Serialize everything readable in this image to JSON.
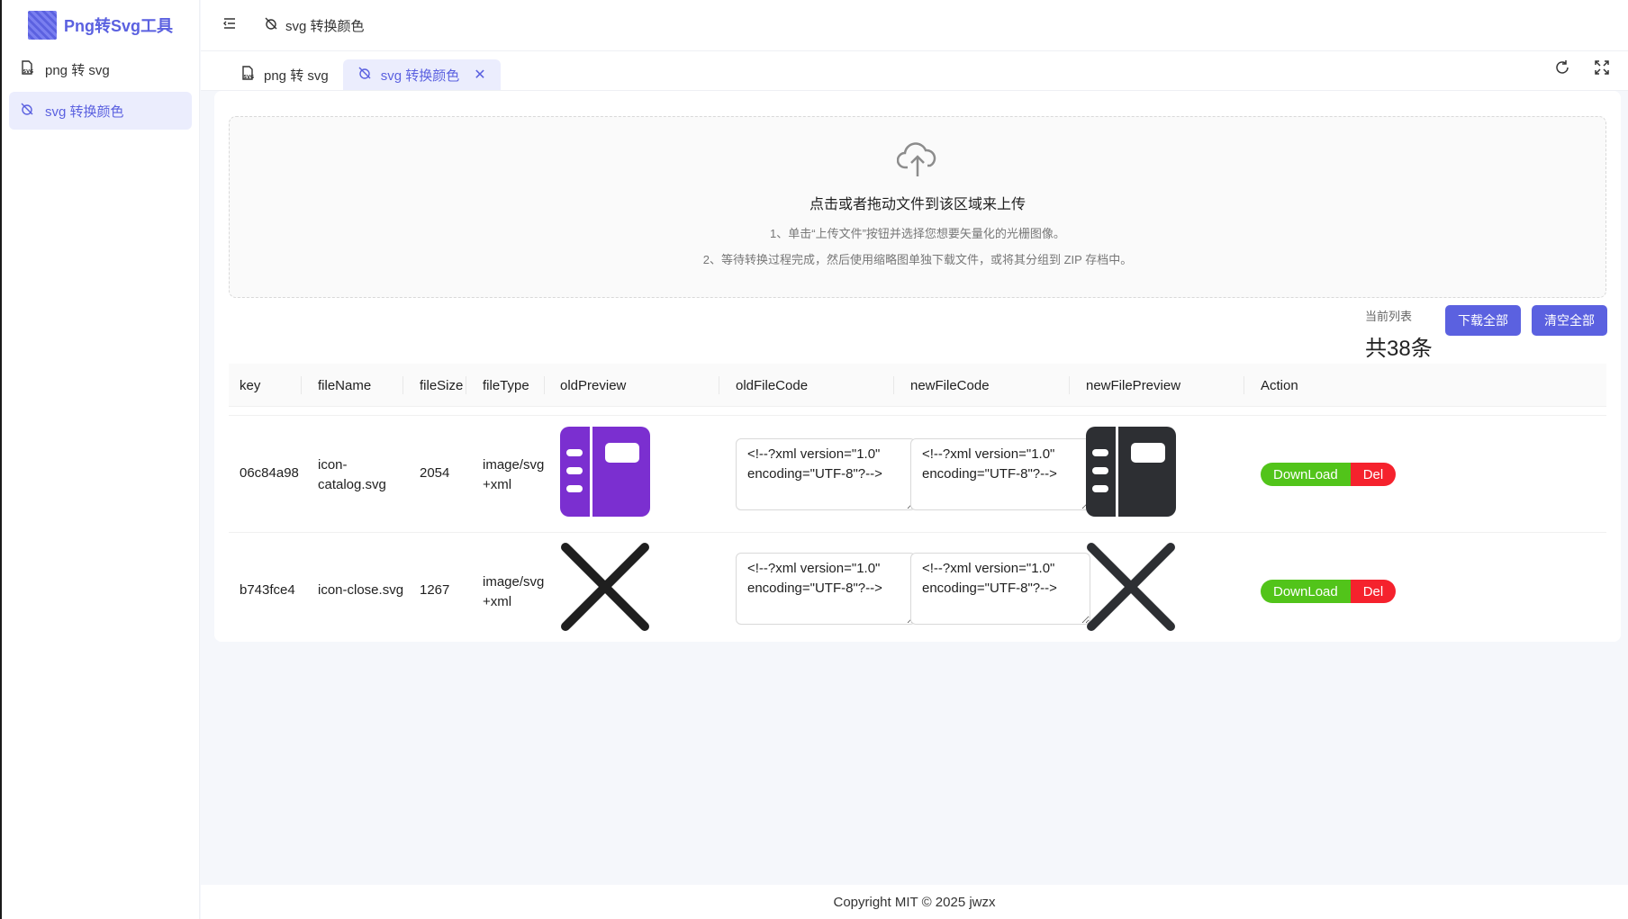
{
  "app": {
    "title": "Png转Svg工具"
  },
  "sidebar": {
    "items": [
      {
        "label": "png 转 svg"
      },
      {
        "label": "svg 转换颜色"
      }
    ]
  },
  "topbar": {
    "breadcrumb": "svg 转换颜色"
  },
  "tabs": [
    {
      "label": "png 转 svg"
    },
    {
      "label": "svg 转换颜色"
    }
  ],
  "upload": {
    "title": "点击或者拖动文件到该区域来上传",
    "hint1": "1、单击“上传文件”按钮并选择您想要矢量化的光栅图像。",
    "hint2": "2、等待转换过程完成，然后使用缩略图单独下载文件，或将其分组到 ZIP 存档中。"
  },
  "list": {
    "label": "当前列表",
    "count": "共38条",
    "download_all": "下载全部",
    "clear_all": "清空全部"
  },
  "table": {
    "headers": [
      "key",
      "fileName",
      "fileSize",
      "fileType",
      "oldPreview",
      "oldFileCode",
      "newFileCode",
      "newFilePreview",
      "Action"
    ],
    "rows": [
      {
        "key": "06c84a98",
        "fileName": "icon-catalog.svg",
        "fileSize": "2054",
        "fileType": "image/svg+xml",
        "oldFileCode": "<!--?xml version=\"1.0\" encoding=\"UTF-8\"?-->",
        "newFileCode": "<!--?xml version=\"1.0\" encoding=\"UTF-8\"?-->",
        "download": "DownLoad",
        "del": "Del"
      },
      {
        "key": "b743fce4",
        "fileName": "icon-close.svg",
        "fileSize": "1267",
        "fileType": "image/svg+xml",
        "oldFileCode": "<!--?xml version=\"1.0\" encoding=\"UTF-8\"?-->",
        "newFileCode": "<!--?xml version=\"1.0\" encoding=\"UTF-8\"?-->",
        "download": "DownLoad",
        "del": "Del"
      }
    ]
  },
  "footer": {
    "copyright": "Copyright MIT © 2025 jwzx"
  },
  "colors": {
    "accent": "#5b61e0",
    "old_icon": "#7b2fd0",
    "new_icon": "#2d2f33",
    "download": "#52c41a",
    "delete": "#f5222d"
  }
}
